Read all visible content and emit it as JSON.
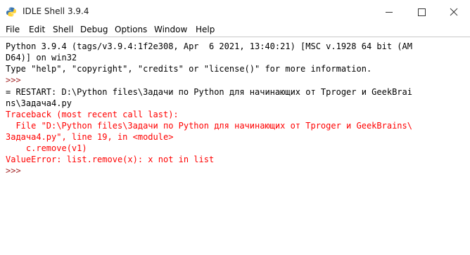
{
  "window": {
    "title": "IDLE Shell 3.9.4"
  },
  "menu": [
    "File",
    "Edit",
    "Shell",
    "Debug",
    "Options",
    "Window",
    "Help"
  ],
  "shell": {
    "lines": [
      {
        "text": "Python 3.9.4 (tags/v3.9.4:1f2e308, Apr  6 2021, 13:40:21) [MSC v.1928 64 bit (AM",
        "kind": "norm"
      },
      {
        "text": "D64)] on win32",
        "kind": "norm"
      },
      {
        "text": "Type \"help\", \"copyright\", \"credits\" or \"license()\" for more information.",
        "kind": "norm"
      },
      {
        "text": ">>>",
        "kind": "prompt"
      },
      {
        "text": "= RESTART: D:\\Python files\\Задачи по Python для начинающих от Tproger и GeekBrai",
        "kind": "norm"
      },
      {
        "text": "ns\\Задача4.py",
        "kind": "norm"
      },
      {
        "text": "Traceback (most recent call last):",
        "kind": "err"
      },
      {
        "text": "  File \"D:\\Python files\\Задачи по Python для начинающих от Tproger и GeekBrains\\",
        "kind": "err"
      },
      {
        "text": "Задача4.py\", line 19, in <module>",
        "kind": "err"
      },
      {
        "text": "    c.remove(v1)",
        "kind": "err"
      },
      {
        "text": "ValueError: list.remove(x): x not in list",
        "kind": "err"
      },
      {
        "text": ">>>",
        "kind": "prompt"
      }
    ]
  },
  "colors": {
    "normal_text": "#000000",
    "prompt": "#a52a2a",
    "error": "#ff0000"
  }
}
